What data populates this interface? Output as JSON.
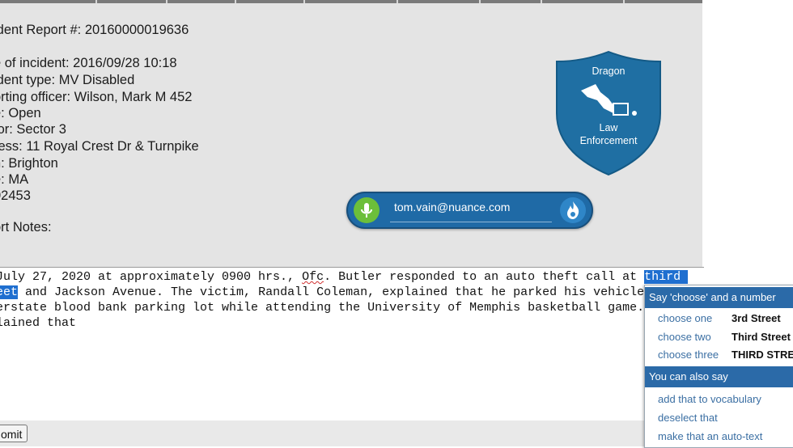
{
  "report": {
    "number": "ident Report #: 20160000019636",
    "fields": [
      "e of incident: 2016/09/28 10:18",
      "ident type: MV Disabled",
      "orting officer: Wilson, Mark M 452",
      "e: Open",
      "tor: Sector 3",
      "ress: 11 Royal Crest Dr & Turnpike",
      "n: Brighton",
      "e: MA",
      " 02453"
    ],
    "notes_label": "ort Notes:"
  },
  "shield": {
    "title": "Dragon",
    "subtitle_line1": "Law",
    "subtitle_line2": "Enforcement",
    "color": "#1f6fa3"
  },
  "dictation_bar": {
    "user": "tom.vain@nuance.com",
    "mic_icon": "microphone-icon",
    "menu_icon": "dragon-flame-icon"
  },
  "editor": {
    "line1_before": "July 27, 2020 at approximately 0900 hrs., ",
    "line1_ofc": "Ofc",
    "line1_mid": ". Butler responded to an auto theft call at ",
    "line1_sel": "third ",
    "line2_sel": "eet",
    "line2_after": " and Jackson Avenue. The victim, Randall Coleman, explained that he parked his vehicle",
    "line3": "erstate blood bank parking lot while attending the University of Memphis basketball game.",
    "line4": "lained that"
  },
  "submit_label": "omit",
  "correction_menu": {
    "header": "Say 'choose' and a number",
    "choices": [
      {
        "cmd": "choose one",
        "value": "3rd Street"
      },
      {
        "cmd": "choose two",
        "value": "Third Street"
      },
      {
        "cmd": "choose three",
        "value": "THIRD STREET"
      }
    ],
    "also_header": "You can also say",
    "also_items": [
      "add that to vocabulary",
      "deselect that",
      "make that an auto-text"
    ]
  }
}
